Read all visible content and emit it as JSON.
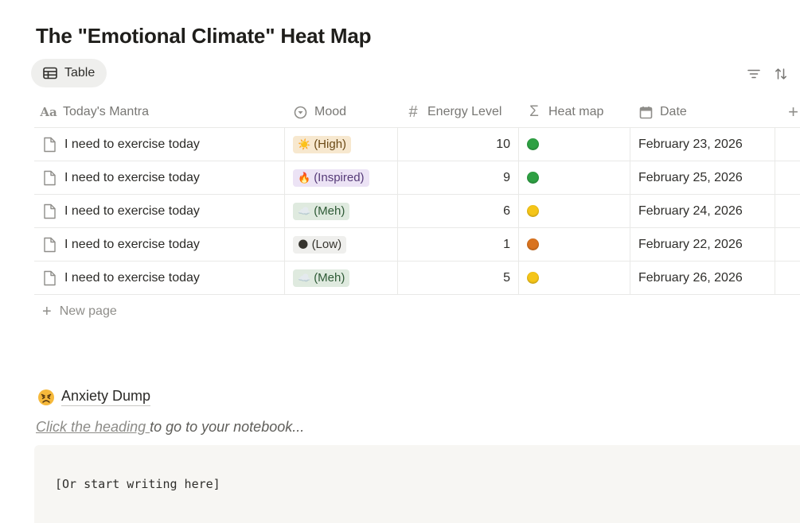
{
  "page": {
    "title": "The \"Emotional Climate\" Heat Map"
  },
  "view": {
    "tab_label": "Table",
    "tab_icon": "table-icon",
    "toolbar_icons": [
      "filter-icon",
      "sort-icon"
    ]
  },
  "table": {
    "columns": [
      {
        "label": "Today's Mantra",
        "icon": "text-property-icon"
      },
      {
        "label": "Mood",
        "icon": "select-property-icon"
      },
      {
        "label": "Energy Level",
        "icon": "number-property-icon"
      },
      {
        "label": "Heat map",
        "icon": "formula-property-icon"
      },
      {
        "label": "Date",
        "icon": "calendar-icon"
      },
      {
        "label": "+",
        "icon": "add-property-icon"
      }
    ],
    "rows": [
      {
        "mantra": "I need to exercise today",
        "mood_emoji": "☀️",
        "mood_text": "(High)",
        "mood_bg": "#f7e8cf",
        "mood_color": "#6b4a16",
        "energy": "10",
        "heat_color": "#2ea043",
        "date": "February 23, 2026"
      },
      {
        "mantra": "I need to exercise today",
        "mood_emoji": "🔥",
        "mood_text": "(Inspired)",
        "mood_bg": "#ece3f5",
        "mood_color": "#553a78",
        "energy": "9",
        "heat_color": "#2ea043",
        "date": "February 25, 2026"
      },
      {
        "mantra": "I need to exercise today",
        "mood_emoji": "☁️",
        "mood_text": "(Meh)",
        "mood_bg": "#dfeadf",
        "mood_color": "#2e5a36",
        "energy": "6",
        "heat_color": "#f5c518",
        "date": "February 24, 2026"
      },
      {
        "mantra": "I need to exercise today",
        "mood_emoji": "🌑",
        "mood_text": "(Low)",
        "mood_bg": "#efefed",
        "mood_color": "#37352f",
        "energy": "1",
        "heat_color": "#d9731f",
        "date": "February 22, 2026"
      },
      {
        "mantra": "I need to exercise today",
        "mood_emoji": "☁️",
        "mood_text": "(Meh)",
        "mood_bg": "#dfeadf",
        "mood_color": "#2e5a36",
        "energy": "5",
        "heat_color": "#f5c518",
        "date": "February 26, 2026"
      }
    ],
    "new_page_label": "New page"
  },
  "anxiety": {
    "heading": "Anxiety Dump",
    "heading_icon": "angry-face-icon",
    "hint_link": "Click the heading ",
    "hint_rest": "to go to your notebook...",
    "code_text": "[Or start writing here]"
  }
}
